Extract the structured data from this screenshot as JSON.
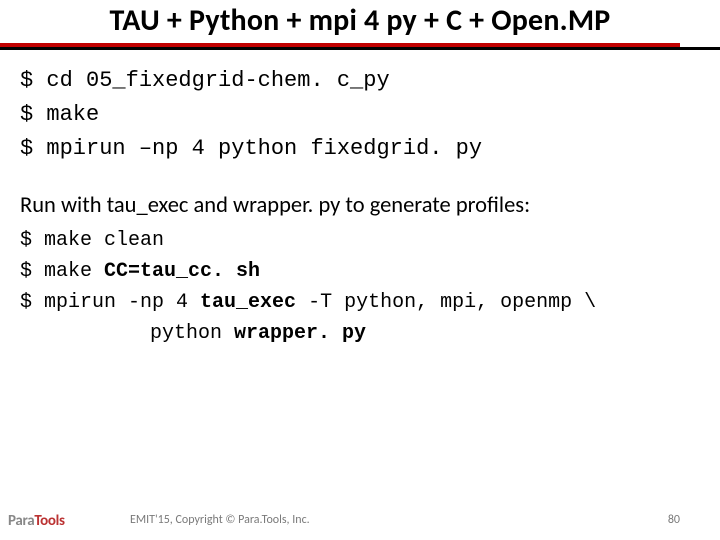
{
  "title": "TAU + Python + mpi 4 py + C + Open.MP",
  "code_block1": {
    "lines": [
      {
        "prompt": "$ ",
        "text": "cd 05_fixedgrid-chem. c_py"
      },
      {
        "prompt": "$ ",
        "text": "make"
      },
      {
        "prompt": "$ ",
        "text": "mpirun –np 4 python fixedgrid. py"
      }
    ]
  },
  "caption": "Run with tau_exec and wrapper. py to generate profiles:",
  "code_block2": {
    "lines": [
      {
        "prompt": "$ ",
        "pre": "make clean",
        "bold": "",
        "post": ""
      },
      {
        "prompt": "$ ",
        "pre": "make ",
        "bold": "CC=tau_cc. sh",
        "post": ""
      },
      {
        "prompt": "$ ",
        "pre": "mpirun -np 4 ",
        "bold": "tau_exec",
        "post": " -T python, mpi, openmp \\"
      }
    ],
    "cont": {
      "pre": "python ",
      "bold": "wrapper. py"
    }
  },
  "footer": {
    "logo_para": "Para",
    "logo_tools": "Tools",
    "copyright": "EMIT'15, Copyright © Para.Tools, Inc.",
    "page": "80"
  }
}
